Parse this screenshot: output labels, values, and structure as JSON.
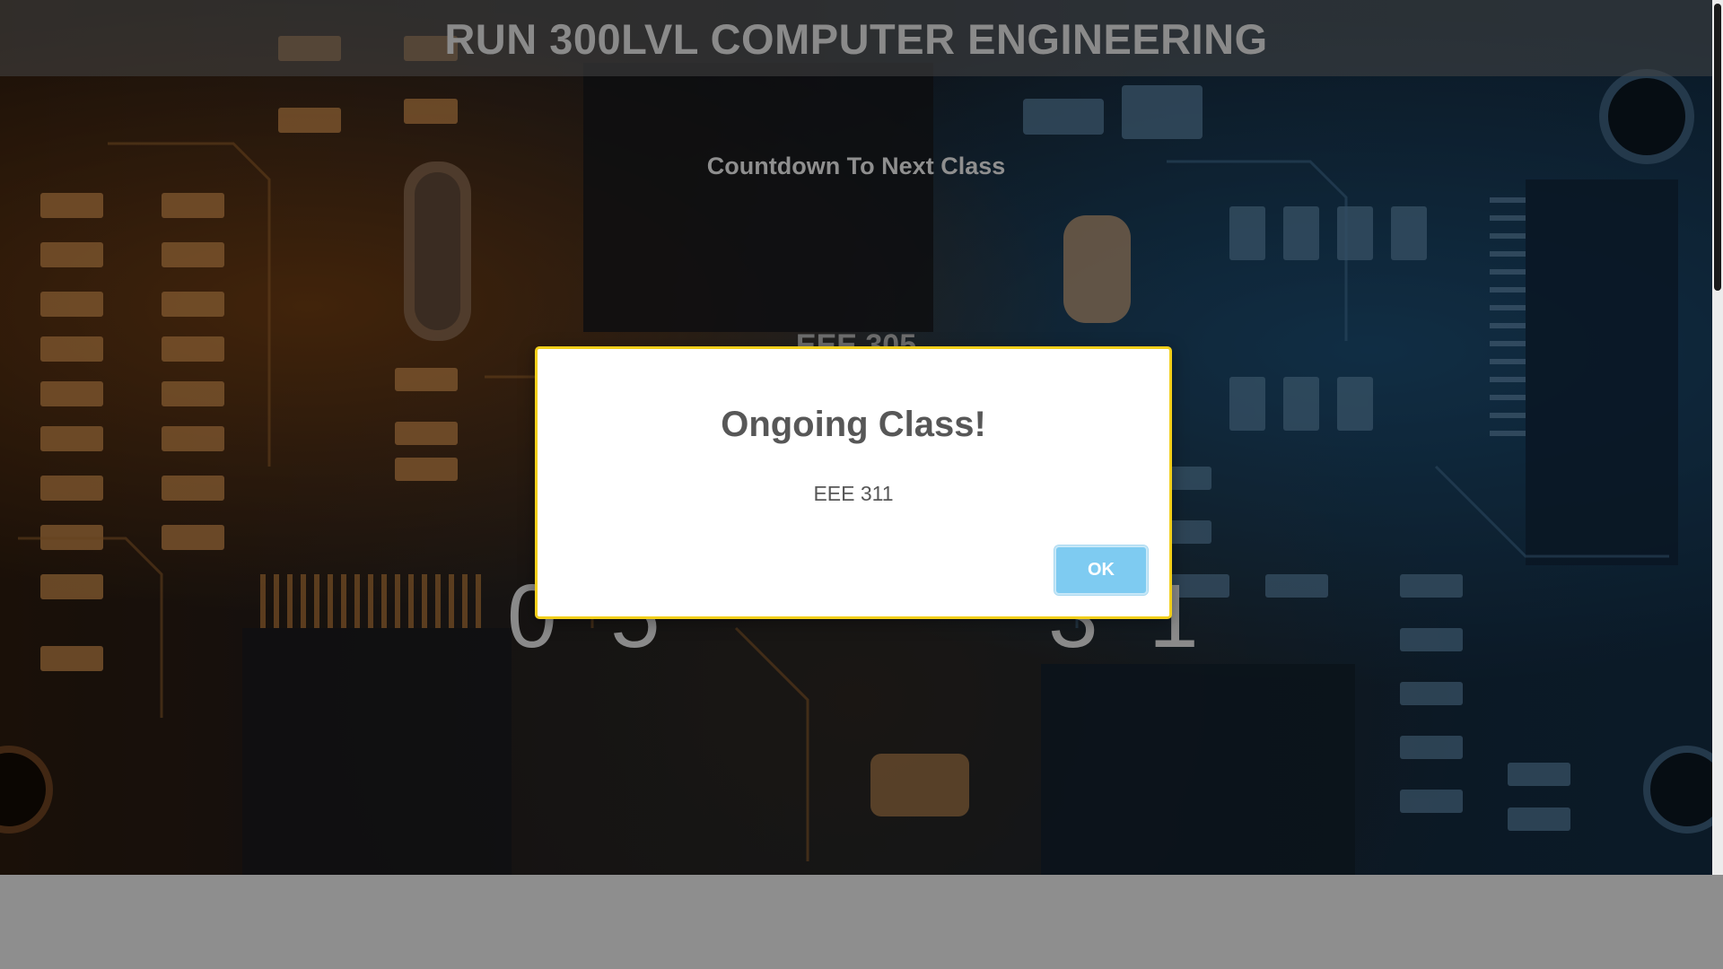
{
  "header": {
    "title": "RUN 300LVL COMPUTER ENGINEERING"
  },
  "countdown": {
    "title": "Countdown To Next Class",
    "course": "EEE 305",
    "digits": [
      "0",
      "5",
      "3",
      "1"
    ]
  },
  "modal": {
    "title": "Ongoing Class!",
    "text": "EEE 311",
    "ok_label": "OK"
  },
  "colors": {
    "modal_border": "#f2cf1b",
    "ok_button": "#7ecbf1",
    "bottom_strip": "#8e8e8e"
  }
}
